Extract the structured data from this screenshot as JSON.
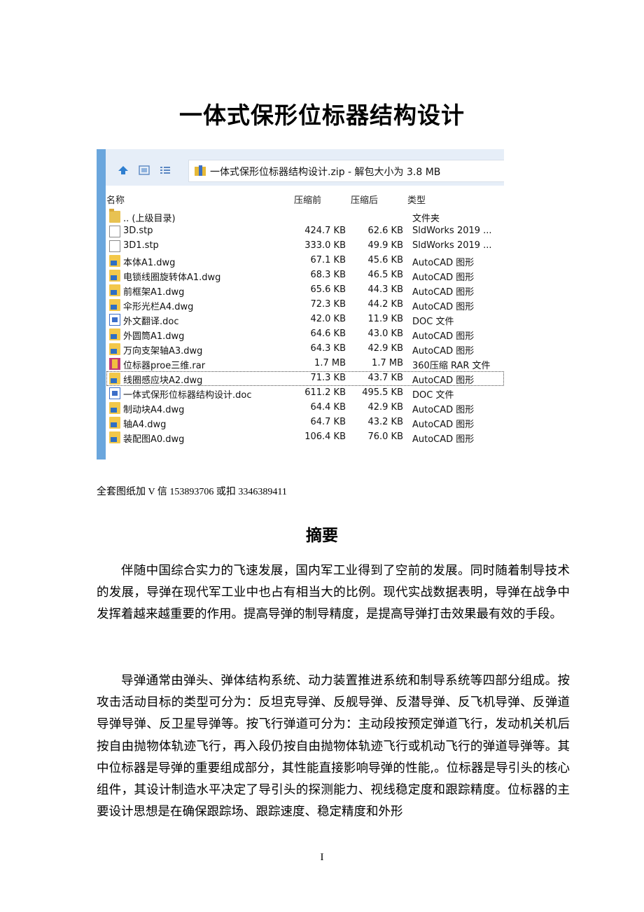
{
  "title": "一体式保形位标器结构设计",
  "zip_window": {
    "address_text": "一体式保形位标器结构设计.zip - 解包大小为 3.8 MB",
    "columns": {
      "name": "名称",
      "before": "压缩前",
      "after": "压缩后",
      "type": "类型"
    },
    "rows": [
      {
        "name": ".. (上级目录)",
        "before": "",
        "after": "",
        "type": "文件夹",
        "icon": "folder-icon"
      },
      {
        "name": "3D.stp",
        "before": "424.7 KB",
        "after": "62.6 KB",
        "type": "SldWorks 2019 ...",
        "icon": "file-icon"
      },
      {
        "name": "3D1.stp",
        "before": "333.0 KB",
        "after": "49.9 KB",
        "type": "SldWorks 2019 ...",
        "icon": "file-icon"
      },
      {
        "name": "本体A1.dwg",
        "before": "67.1 KB",
        "after": "45.6 KB",
        "type": "AutoCAD 图形",
        "icon": "dwg-icon"
      },
      {
        "name": "电锁线圈旋转体A1.dwg",
        "before": "68.3 KB",
        "after": "46.5 KB",
        "type": "AutoCAD 图形",
        "icon": "dwg-icon"
      },
      {
        "name": "前框架A1.dwg",
        "before": "65.6 KB",
        "after": "44.3 KB",
        "type": "AutoCAD 图形",
        "icon": "dwg-icon"
      },
      {
        "name": "伞形光栏A4.dwg",
        "before": "72.3 KB",
        "after": "44.2 KB",
        "type": "AutoCAD 图形",
        "icon": "dwg-icon"
      },
      {
        "name": "外文翻译.doc",
        "before": "42.0 KB",
        "after": "11.9 KB",
        "type": "DOC 文件",
        "icon": "doc-icon"
      },
      {
        "name": "外圆筒A1.dwg",
        "before": "64.6 KB",
        "after": "43.0 KB",
        "type": "AutoCAD 图形",
        "icon": "dwg-icon"
      },
      {
        "name": "万向支架轴A3.dwg",
        "before": "64.3 KB",
        "after": "42.9 KB",
        "type": "AutoCAD 图形",
        "icon": "dwg-icon"
      },
      {
        "name": "位标器proe三维.rar",
        "before": "1.7 MB",
        "after": "1.7 MB",
        "type": "360压缩 RAR 文件",
        "icon": "rar-icon"
      },
      {
        "name": "线圈感应块A2.dwg",
        "before": "71.3 KB",
        "after": "43.7 KB",
        "type": "AutoCAD 图形",
        "icon": "dwg-icon",
        "selected": true
      },
      {
        "name": "一体式保形位标器结构设计.doc",
        "before": "611.2 KB",
        "after": "495.5 KB",
        "type": "DOC 文件",
        "icon": "doc-icon"
      },
      {
        "name": "制动块A4.dwg",
        "before": "64.4 KB",
        "after": "42.9 KB",
        "type": "AutoCAD 图形",
        "icon": "dwg-icon"
      },
      {
        "name": "轴A4.dwg",
        "before": "64.7 KB",
        "after": "43.2 KB",
        "type": "AutoCAD 图形",
        "icon": "dwg-icon"
      },
      {
        "name": "装配图A0.dwg",
        "before": "106.4 KB",
        "after": "76.0 KB",
        "type": "AutoCAD 图形",
        "icon": "dwg-icon"
      }
    ]
  },
  "contact": "全套图纸加 V 信 153893706 或扣  3346389411",
  "abstract_title": "摘要",
  "paragraphs": [
    "伴随中国综合实力的飞速发展，国内军工业得到了空前的发展。同时随着制导技术的发展，导弹在现代军工业中也占有相当大的比例。现代实战数据表明，导弹在战争中发挥着越来越重要的作用。提高导弹的制导精度，是提高导弹打击效果最有效的手段。",
    "导弹通常由弹头、弹体结构系统、动力装置推进系统和制导系统等四部分组成。按攻击活动目标的类型可分为：反坦克导弹、反舰导弹、反潜导弹、反飞机导弹、反弹道导弹导弹、反卫星导弹等。按飞行弹道可分为：主动段按预定弹道飞行，发动机关机后按自由抛物体轨迹飞行，再入段仍按自由抛物体轨迹飞行或机动飞行的弹道导弹等。其中位标器是导弹的重要组成部分，其性能直接影响导弹的性能,。位标器是导引头的核心组件，其设计制造水平决定了导引头的探测能力、视线稳定度和跟踪精度。位标器的主要设计思想是在确保跟踪场、跟踪速度、稳定精度和外形"
  ],
  "page_number": "I"
}
